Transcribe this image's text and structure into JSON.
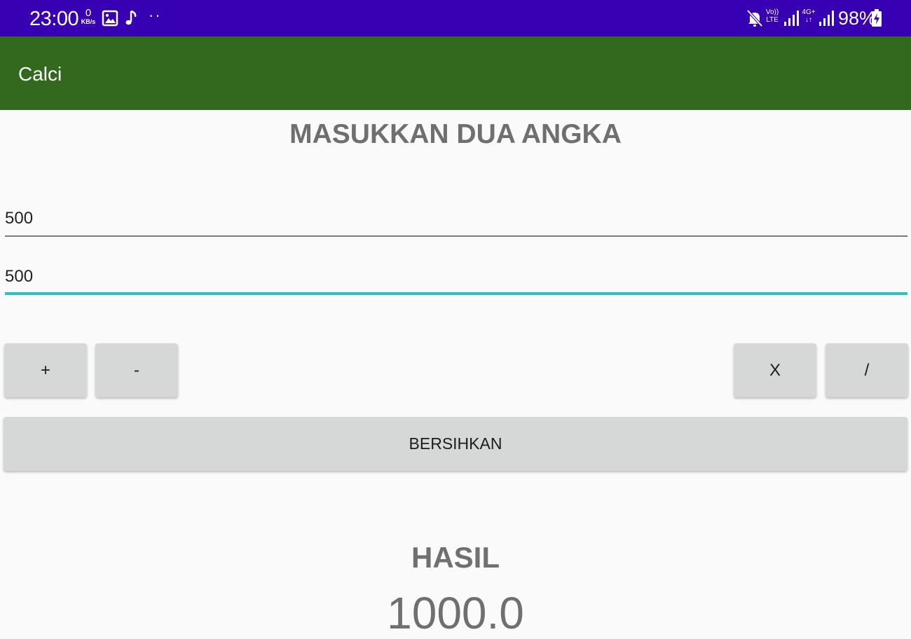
{
  "status_bar": {
    "time": "23:00",
    "net_speed_value": "0",
    "net_speed_unit": "KB/s",
    "volte_top": "Vo))",
    "volte_bottom": "LTE",
    "network_top": "4G+",
    "network_bottom": "↓↑",
    "battery": "98%",
    "icons": [
      "image-icon",
      "music-note-icon",
      "more-dots-icon",
      "mute-icon",
      "signal-icon",
      "battery-charging-icon"
    ]
  },
  "app_bar": {
    "title": "Calci"
  },
  "main": {
    "heading": "MASUKKAN DUA ANGKA",
    "input1_value": "500",
    "input2_value": "500",
    "buttons": {
      "add": "+",
      "subtract": "-",
      "multiply": "X",
      "divide": "/"
    },
    "clear_label": "BERSIHKAN",
    "result_label": "HASIL",
    "result_value": "1000.0"
  },
  "colors": {
    "status_bar": "#3700b3",
    "app_bar": "#33691e",
    "focused_underline": "#26c6c6",
    "button": "#d6d7d7"
  }
}
